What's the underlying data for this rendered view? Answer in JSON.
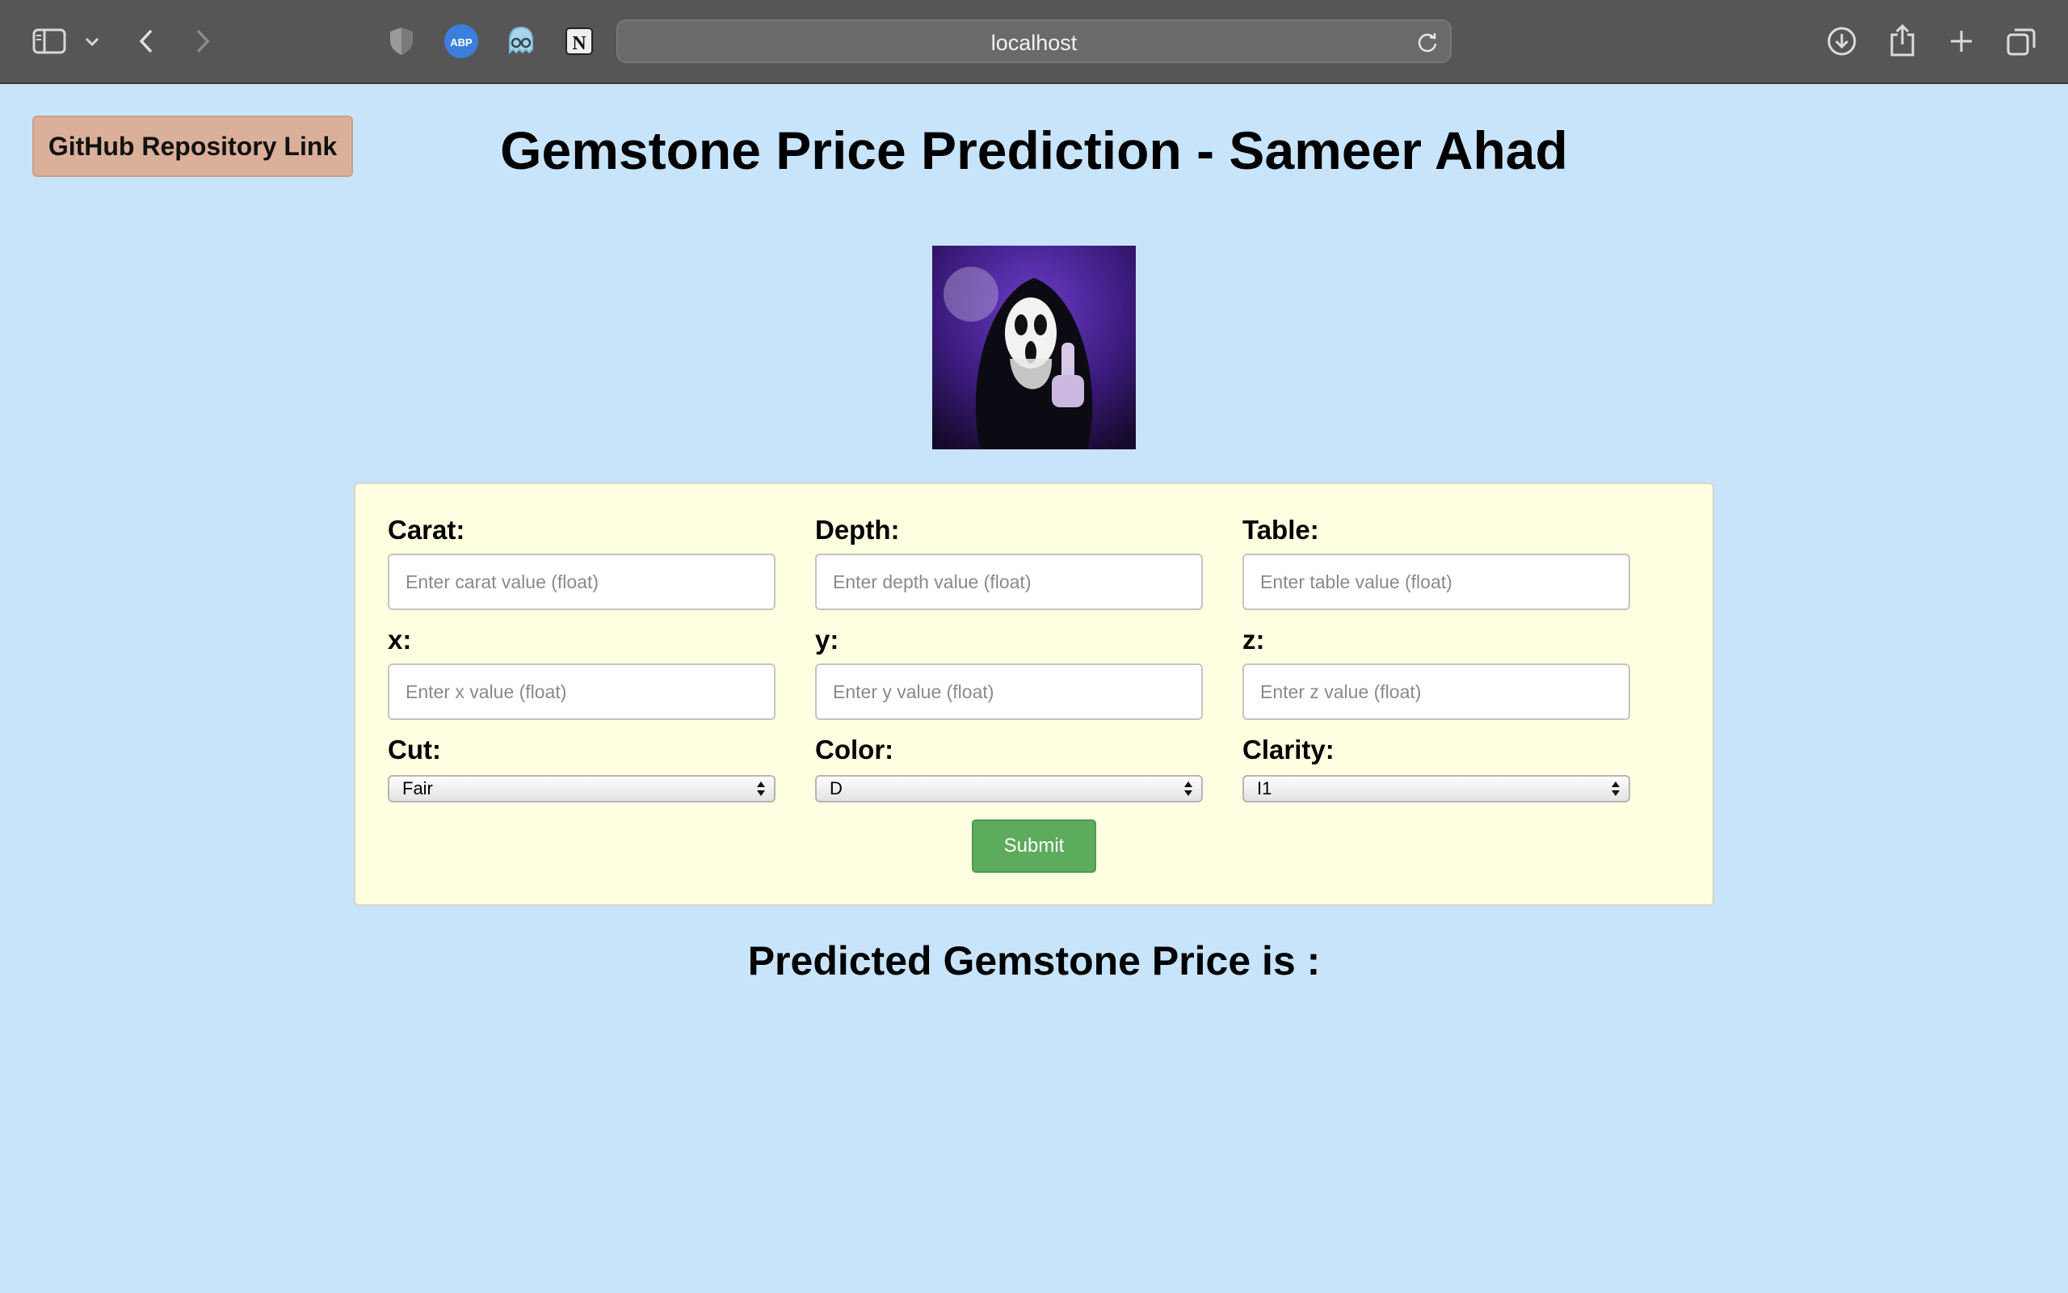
{
  "browser": {
    "url": "localhost"
  },
  "page": {
    "github_link_label": "GitHub Repository Link",
    "title": "Gemstone Price Prediction - Sameer Ahad",
    "result_label": "Predicted Gemstone Price is :"
  },
  "form": {
    "carat": {
      "label": "Carat:",
      "placeholder": "Enter carat value (float)"
    },
    "depth": {
      "label": "Depth:",
      "placeholder": "Enter depth value (float)"
    },
    "table": {
      "label": "Table:",
      "placeholder": "Enter table value (float)"
    },
    "x": {
      "label": "x:",
      "placeholder": "Enter x value (float)"
    },
    "y": {
      "label": "y:",
      "placeholder": "Enter y value (float)"
    },
    "z": {
      "label": "z:",
      "placeholder": "Enter z value (float)"
    },
    "cut": {
      "label": "Cut:",
      "selected": "Fair"
    },
    "color": {
      "label": "Color:",
      "selected": "D"
    },
    "clarity": {
      "label": "Clarity:",
      "selected": "I1"
    },
    "submit_label": "Submit"
  },
  "colors": {
    "page_background": "#c8e4fa",
    "form_background": "#ffffe2",
    "github_button": "#dab09a",
    "submit_button": "#5dab5c"
  }
}
